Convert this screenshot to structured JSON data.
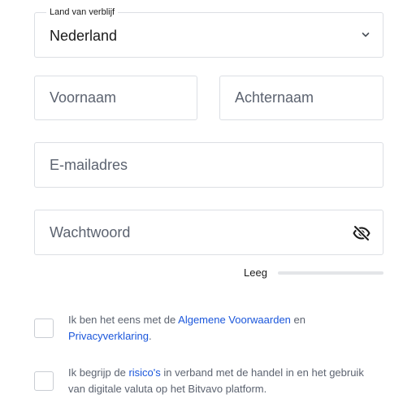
{
  "colors": {
    "link": "#1a56db",
    "border": "#dcdfe4",
    "muted_text": "#5c6370"
  },
  "country": {
    "label": "Land van verblijf",
    "value": "Nederland",
    "icon": "chevron-down-icon"
  },
  "first_name": {
    "placeholder": "Voornaam",
    "value": ""
  },
  "last_name": {
    "placeholder": "Achternaam",
    "value": ""
  },
  "email": {
    "placeholder": "E-mailadres",
    "value": ""
  },
  "password": {
    "placeholder": "Wachtwoord",
    "value": "",
    "toggle_icon": "eye-slash-icon"
  },
  "password_strength": {
    "label": "Leeg",
    "level": 0
  },
  "consent_terms": {
    "checked": false,
    "text_before": "Ik ben het eens met de ",
    "link_terms": "Algemene Voorwaarden",
    "text_middle": " en ",
    "link_privacy": "Privacyverklaring",
    "text_after": "."
  },
  "consent_risks": {
    "checked": false,
    "text_before": "Ik begrijp de ",
    "link_risks": "risico's",
    "text_after": " in verband met de handel in en het gebruik van digitale valuta op het Bitvavo platform."
  }
}
